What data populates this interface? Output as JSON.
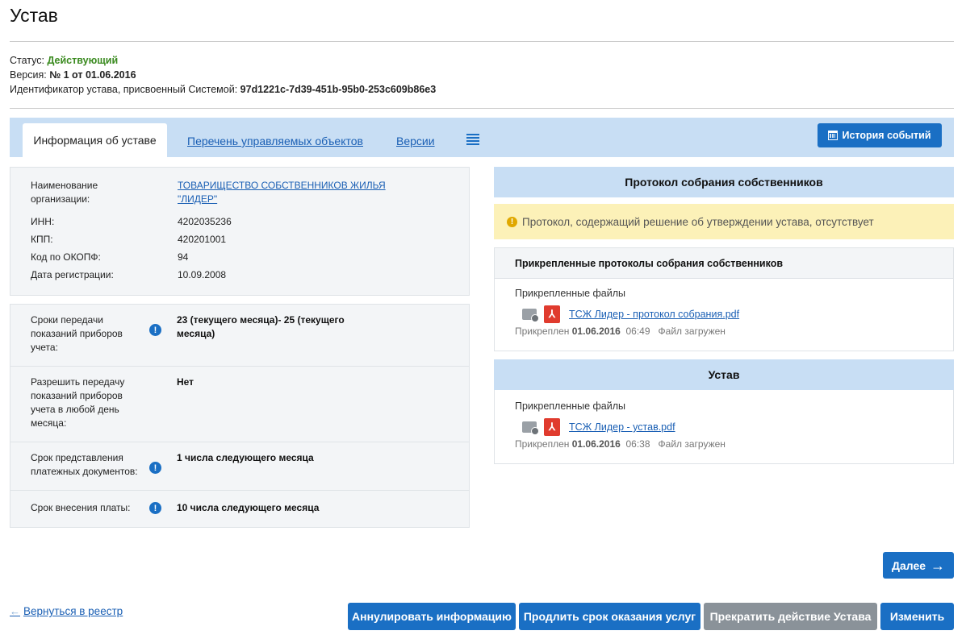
{
  "page": {
    "title": "Устав"
  },
  "meta": {
    "status_label": "Статус:",
    "status_value": "Действующий",
    "version_label": "Версия:",
    "version_value": "№ 1 от 01.06.2016",
    "id_label": "Идентификатор устава, присвоенный Системой:",
    "id_value": "97d1221c-7d39-451b-95b0-253c609b86e3"
  },
  "tabs": {
    "active": "Информация об уставе",
    "objects": "Перечень управляемых объектов",
    "versions": "Версии",
    "history_button": "История событий"
  },
  "org": {
    "name_label": "Наименование организации:",
    "name_value": "ТОВАРИЩЕСТВО СОБСТВЕННИКОВ ЖИЛЬЯ \"ЛИДЕР\"",
    "inn_label": "ИНН:",
    "inn_value": "4202035236",
    "kpp_label": "КПП:",
    "kpp_value": "420201001",
    "okopf_label": "Код по ОКОПФ:",
    "okopf_value": "94",
    "regdate_label": "Дата регистрации:",
    "regdate_value": "10.09.2008"
  },
  "terms": {
    "t1_label": "Сроки передачи показаний приборов учета:",
    "t1_value": "23 (текущего месяца)- 25 (текущего месяца)",
    "t2_label": "Разрешить передачу показаний приборов учета в любой день месяца:",
    "t2_value": "Нет",
    "t3_label": "Срок представления платежных документов:",
    "t3_value": "1 числа следующего месяца",
    "t4_label": "Срок внесения платы:",
    "t4_value": "10 числа следующего месяца"
  },
  "protocol": {
    "header": "Протокол собрания собственников",
    "warning": "Протокол, содержащий решение об утверждении устава, отсутствует",
    "attached_header": "Прикрепленные протоколы собрания собственников",
    "files_label": "Прикрепленные файлы",
    "file_name": "ТСЖ Лидер - протокол собрания.pdf",
    "attached_word": "Прикреплен",
    "attached_date": "01.06.2016",
    "attached_time": "06:49",
    "upload_status": "Файл загружен"
  },
  "charter": {
    "header": "Устав",
    "files_label": "Прикрепленные файлы",
    "file_name": "ТСЖ Лидер - устав.pdf",
    "attached_word": "Прикреплен",
    "attached_date": "01.06.2016",
    "attached_time": "06:38",
    "upload_status": "Файл загружен"
  },
  "actions": {
    "next": "Далее",
    "back": "Вернуться в реестр",
    "annul": "Аннулировать информацию",
    "extend": "Продлить срок оказания услуг",
    "terminate": "Прекратить действие Устава",
    "edit": "Изменить"
  },
  "colors": {
    "accent": "#1a6fc4",
    "tab_bar": "#c8def4",
    "status_green": "#3a8a1f",
    "warning_bg": "#fcf1b8",
    "pdf_red": "#e03b2e",
    "disabled_gray": "#8a9299"
  }
}
